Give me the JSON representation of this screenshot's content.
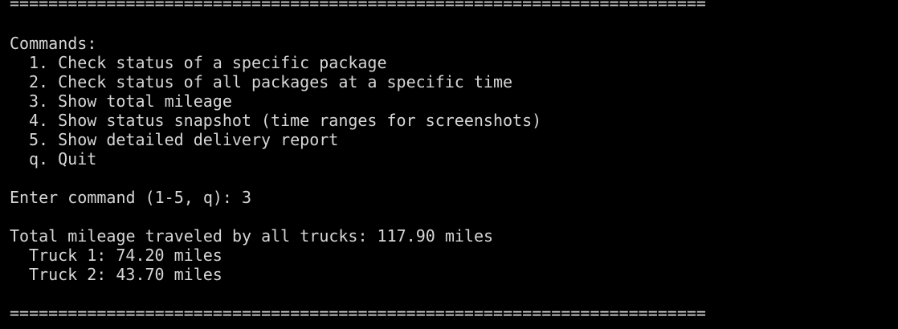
{
  "separator": "========================================================================",
  "commands_header": "Commands:",
  "commands": [
    "1. Check status of a specific package",
    "2. Check status of all packages at a specific time",
    "3. Show total mileage",
    "4. Show status snapshot (time ranges for screenshots)",
    "5. Show detailed delivery report",
    "q. Quit"
  ],
  "prompt": "Enter command (1-5, q): 3",
  "result": {
    "total": "Total mileage traveled by all trucks: 117.90 miles",
    "trucks": [
      "Truck 1: 74.20 miles",
      "Truck 2: 43.70 miles"
    ]
  },
  "colors": {
    "background": "#000000",
    "text": "#d6d6d6"
  }
}
